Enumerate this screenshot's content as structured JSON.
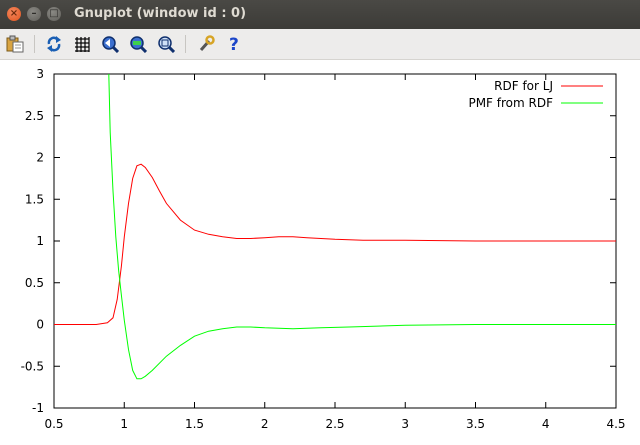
{
  "window": {
    "title": "Gnuplot (window id : 0)",
    "close_glyph": "×",
    "min_glyph": "–",
    "max_glyph": "□"
  },
  "toolbar": {
    "icons": [
      "copy-to-clipboard-icon",
      "replot-icon",
      "grid-icon",
      "previous-zoom-icon",
      "next-zoom-icon",
      "autoscale-icon",
      "preferences-icon",
      "help-icon"
    ]
  },
  "chart_data": {
    "type": "line",
    "xlim": [
      0.5,
      4.5
    ],
    "ylim": [
      -1,
      3
    ],
    "xticks": [
      "0.5",
      "1",
      "1.5",
      "2",
      "2.5",
      "3",
      "3.5",
      "4",
      "4.5"
    ],
    "yticks": [
      "3",
      "2.5",
      "2",
      "1.5",
      "1",
      "0.5",
      "0",
      "-0.5",
      "-1"
    ],
    "legend_position": "top-right",
    "grid": false,
    "series": [
      {
        "name": "RDF for LJ",
        "color": "#ff0000",
        "x": [
          0.5,
          0.8,
          0.88,
          0.92,
          0.95,
          0.98,
          1.0,
          1.03,
          1.06,
          1.09,
          1.12,
          1.15,
          1.2,
          1.25,
          1.3,
          1.4,
          1.5,
          1.6,
          1.7,
          1.8,
          1.9,
          2.0,
          2.1,
          2.2,
          2.3,
          2.4,
          2.5,
          2.7,
          3.0,
          3.5,
          4.0,
          4.5
        ],
        "y": [
          0.0,
          0.0,
          0.02,
          0.08,
          0.3,
          0.7,
          1.05,
          1.45,
          1.75,
          1.9,
          1.92,
          1.88,
          1.76,
          1.6,
          1.45,
          1.25,
          1.13,
          1.08,
          1.05,
          1.03,
          1.03,
          1.04,
          1.05,
          1.05,
          1.04,
          1.03,
          1.02,
          1.01,
          1.01,
          1.0,
          1.0,
          1.0
        ]
      },
      {
        "name": "PMF from RDF",
        "color": "#00ff00",
        "x": [
          0.89,
          0.9,
          0.92,
          0.94,
          0.96,
          0.98,
          1.0,
          1.03,
          1.06,
          1.09,
          1.12,
          1.15,
          1.2,
          1.3,
          1.4,
          1.5,
          1.6,
          1.7,
          1.8,
          1.9,
          2.0,
          2.2,
          2.4,
          2.6,
          3.0,
          3.5,
          4.0,
          4.5
        ],
        "y": [
          3.0,
          2.3,
          1.6,
          1.05,
          0.65,
          0.35,
          0.05,
          -0.3,
          -0.55,
          -0.65,
          -0.65,
          -0.62,
          -0.55,
          -0.38,
          -0.25,
          -0.14,
          -0.08,
          -0.05,
          -0.03,
          -0.03,
          -0.04,
          -0.05,
          -0.04,
          -0.03,
          -0.01,
          0.0,
          0.0,
          0.0
        ]
      }
    ]
  }
}
